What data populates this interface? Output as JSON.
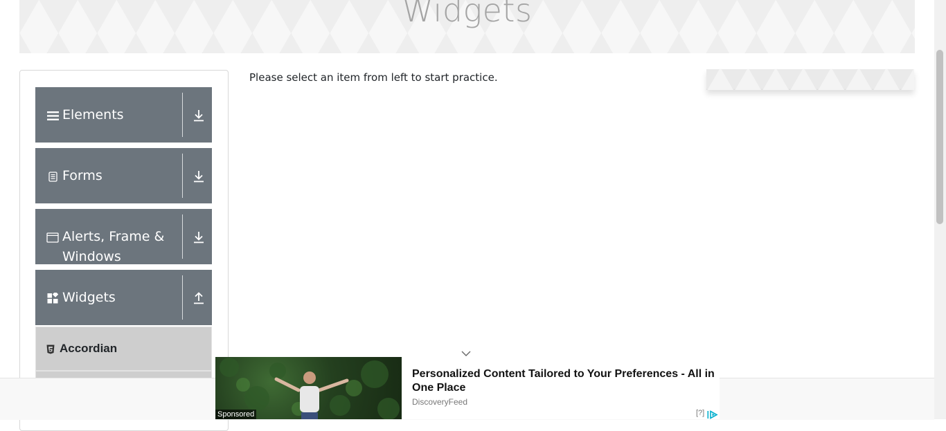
{
  "header": {
    "title": "Widgets"
  },
  "sidebar": {
    "groups": [
      {
        "label": "Elements",
        "icon": "hamburger-icon",
        "toggle": "download-arrow-icon",
        "expanded": false
      },
      {
        "label": "Forms",
        "icon": "document-icon",
        "toggle": "download-arrow-icon",
        "expanded": false
      },
      {
        "label": "Alerts, Frame & Windows",
        "icon": "window-icon",
        "toggle": "download-arrow-icon",
        "expanded": false
      },
      {
        "label": "Widgets",
        "icon": "widgets-grid-icon",
        "toggle": "upload-arrow-icon",
        "expanded": true
      }
    ],
    "widget_items": [
      {
        "label": "Accordian",
        "icon": "html5-icon"
      }
    ]
  },
  "main": {
    "message": "Please select an item from left to start practice."
  },
  "ad": {
    "sponsored_label": "Sponsored",
    "headline": "Personalized Content Tailored to Your Preferences - All in One Place",
    "source": "DiscoveryFeed",
    "info_label": "[?]",
    "icons": [
      "chevron-down-icon",
      "adchoices-icon"
    ]
  },
  "colors": {
    "group_bg": "#6c757d",
    "sub_item_bg": "#cecece",
    "banner_title": "#a4a4a4",
    "adchoices": "#00aecd"
  }
}
